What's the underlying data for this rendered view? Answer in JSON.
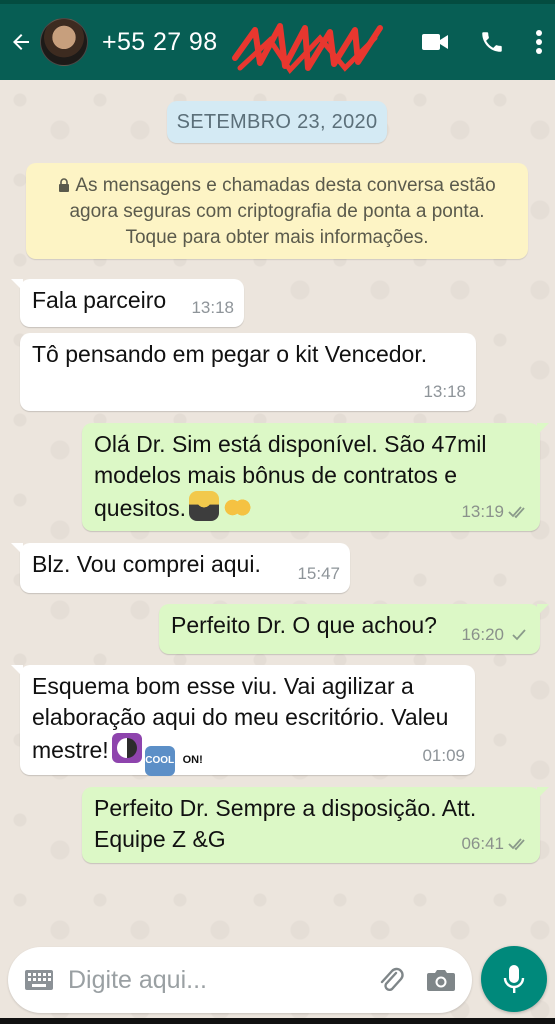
{
  "header": {
    "contact_name": "+55 27 98",
    "back_icon": "arrow-left-icon",
    "video_icon": "video-call-icon",
    "phone_icon": "phone-icon",
    "menu_icon": "more-vert-icon"
  },
  "date_separator": "SETEMBRO 23, 2020",
  "security_notice": "As mensagens e chamadas desta conversa estão agora seguras com criptografia de ponta a ponta. Toque para obter mais informações.",
  "messages": [
    {
      "direction": "in",
      "text": "Fala parceiro",
      "time": "13:18"
    },
    {
      "direction": "in",
      "text": "Tô pensando em pegar o kit Vencedor.",
      "time": "13:18"
    },
    {
      "direction": "out",
      "text": "Olá Dr. Sim está disponível. São 47mil modelos mais bônus de contratos e quesitos.",
      "time": "13:19",
      "status": "read"
    },
    {
      "direction": "in",
      "text": "Blz. Vou comprei aqui.",
      "time": "15:47"
    },
    {
      "direction": "out",
      "text": "Perfeito Dr. O que achou?",
      "time": "16:20",
      "status": "sent"
    },
    {
      "direction": "in",
      "text": "Esquema bom esse viu. Vai agilizar a elaboração aqui do meu escritório. Valeu mestre!",
      "time": "01:09"
    },
    {
      "direction": "out",
      "text": "Perfeito Dr. Sempre a disposição. Att. Equipe Z &G",
      "time": "06:41",
      "status": "read"
    }
  ],
  "emoji_labels": {
    "cool": "COOL",
    "on": "ON!"
  },
  "composer": {
    "placeholder": "Digite aqui...",
    "keyboard_icon": "keyboard-icon",
    "attach_icon": "paperclip-icon",
    "camera_icon": "camera-icon",
    "mic_icon": "microphone-icon"
  },
  "colors": {
    "header": "#075e54",
    "incoming_bubble": "#ffffff",
    "outgoing_bubble": "#dcf8c6",
    "date_pill": "#d4eaf4",
    "security_note": "#fdf4c5",
    "mic_button": "#00897b",
    "redaction": "#e8372f"
  }
}
